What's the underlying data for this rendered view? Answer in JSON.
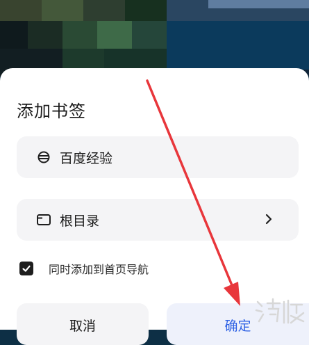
{
  "dialog": {
    "title": "添加书签",
    "name_field": {
      "value": "百度经验",
      "icon": "planet-icon"
    },
    "folder_field": {
      "value": "根目录",
      "icon": "folder-icon",
      "chevron": "›"
    },
    "sync_checkbox": {
      "checked": true,
      "label": "同时添加到首页导航"
    },
    "cancel_button": "取消",
    "confirm_button": "确定"
  },
  "colors": {
    "accent": "#2f62e4",
    "annotation_arrow": "#e8363b"
  },
  "watermark": {
    "text": "游侠网"
  }
}
